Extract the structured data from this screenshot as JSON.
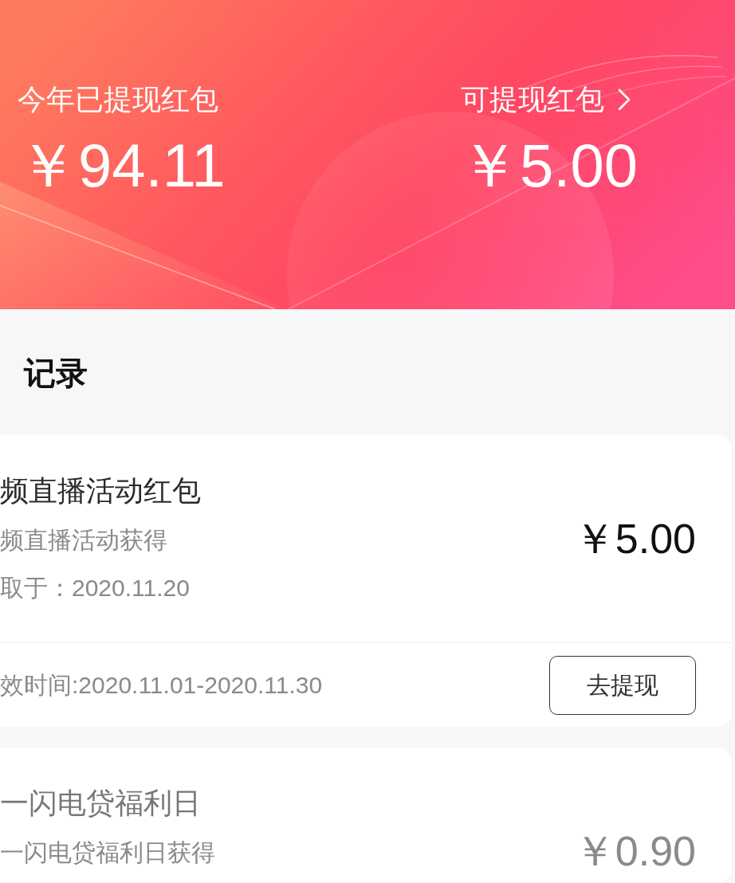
{
  "summary": {
    "withdrawn": {
      "label": "今年已提现红包",
      "amount": "￥94.11"
    },
    "withdrawable": {
      "label": "可提现红包",
      "amount": "￥5.00"
    }
  },
  "records_section": {
    "title": "记录"
  },
  "records": [
    {
      "title": "频直播活动红包",
      "source": "频直播活动获得",
      "received": "取于：2020.11.20",
      "amount": "￥5.00",
      "disabled": false,
      "validity": "效时间:2020.11.01-2020.11.30",
      "action": "去提现"
    },
    {
      "title": "一闪电贷福利日",
      "source": "一闪电贷福利日获得",
      "amount": "￥0.90",
      "disabled": true
    }
  ]
}
